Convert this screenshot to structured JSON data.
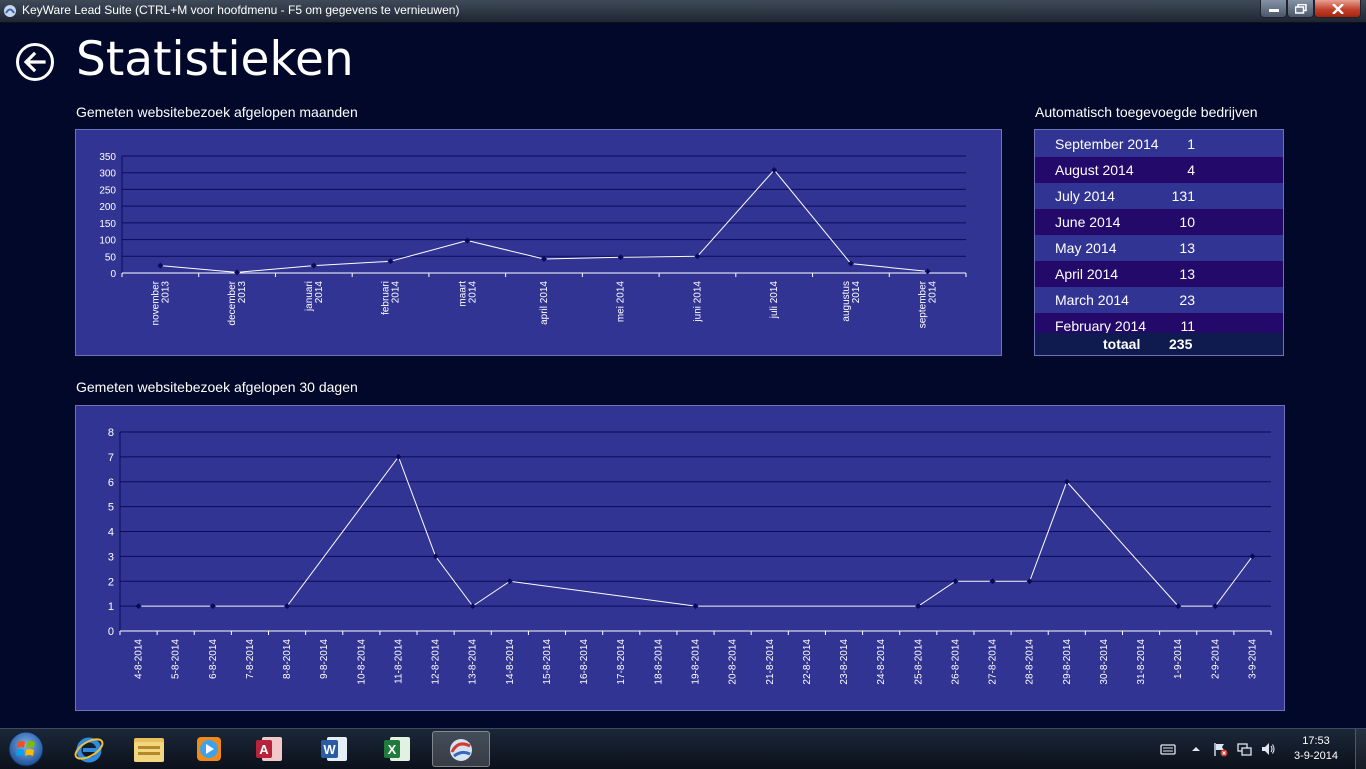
{
  "window": {
    "title": "KeyWare Lead Suite (CTRL+M voor hoofdmenu - F5 om gegevens te vernieuwen)"
  },
  "header": {
    "title": "Statistieken",
    "back_icon": "back-arrow-icon"
  },
  "sections": {
    "monthly_title": "Gemeten websitebezoek afgelopen maanden",
    "daily_title": "Gemeten websitebezoek afgelopen 30 dagen",
    "companies_title": "Automatisch toegevoegde bedrijven"
  },
  "companies": {
    "rows": [
      {
        "month": "September 2014",
        "count": "1"
      },
      {
        "month": "August 2014",
        "count": "4"
      },
      {
        "month": "July 2014",
        "count": "131"
      },
      {
        "month": "June 2014",
        "count": "10"
      },
      {
        "month": "May 2014",
        "count": "13"
      },
      {
        "month": "April 2014",
        "count": "13"
      },
      {
        "month": "March 2014",
        "count": "23"
      },
      {
        "month": "February 2014",
        "count": "11"
      }
    ],
    "total_label": "totaal",
    "total_value": "235"
  },
  "colors": {
    "background": "#010829",
    "panel": "#323494",
    "row_alt": "#230a6a",
    "gridline": "#0a0a5a",
    "line": "#ffffff",
    "marker": "#0a0a5a"
  },
  "chart_data": [
    {
      "type": "line",
      "categories": [
        [
          "november",
          "2013"
        ],
        [
          "december",
          "2013"
        ],
        [
          "januari",
          "2014"
        ],
        [
          "februari",
          "2014"
        ],
        [
          "maart",
          "2014"
        ],
        [
          "april 2014"
        ],
        [
          "mei 2014"
        ],
        [
          "juni 2014"
        ],
        [
          "juli 2014"
        ],
        [
          "augustus",
          "2014"
        ],
        [
          "september",
          "2014"
        ]
      ],
      "values": [
        22,
        2,
        22,
        35,
        97,
        42,
        47,
        50,
        308,
        28,
        5
      ],
      "ylim": [
        0,
        350
      ],
      "yticks": [
        0,
        50,
        100,
        150,
        200,
        250,
        300,
        350
      ],
      "grid": true
    },
    {
      "type": "line",
      "categories": [
        "4-8-2014",
        "5-8-2014",
        "6-8-2014",
        "7-8-2014",
        "8-8-2014",
        "9-8-2014",
        "10-8-2014",
        "11-8-2014",
        "12-8-2014",
        "13-8-2014",
        "14-8-2014",
        "15-8-2014",
        "16-8-2014",
        "17-8-2014",
        "18-8-2014",
        "19-8-2014",
        "20-8-2014",
        "21-8-2014",
        "22-8-2014",
        "23-8-2014",
        "24-8-2014",
        "25-8-2014",
        "26-8-2014",
        "27-8-2014",
        "28-8-2014",
        "29-8-2014",
        "30-8-2014",
        "31-8-2014",
        "1-9-2014",
        "2-9-2014",
        "3-9-2014"
      ],
      "points": [
        {
          "x": "4-8-2014",
          "y": 1
        },
        {
          "x": "6-8-2014",
          "y": 1
        },
        {
          "x": "8-8-2014",
          "y": 1
        },
        {
          "x": "11-8-2014",
          "y": 7
        },
        {
          "x": "12-8-2014",
          "y": 3
        },
        {
          "x": "13-8-2014",
          "y": 1
        },
        {
          "x": "14-8-2014",
          "y": 2
        },
        {
          "x": "19-8-2014",
          "y": 1
        },
        {
          "x": "25-8-2014",
          "y": 1
        },
        {
          "x": "26-8-2014",
          "y": 2
        },
        {
          "x": "27-8-2014",
          "y": 2
        },
        {
          "x": "28-8-2014",
          "y": 2
        },
        {
          "x": "29-8-2014",
          "y": 6
        },
        {
          "x": "1-9-2014",
          "y": 1
        },
        {
          "x": "2-9-2014",
          "y": 1
        },
        {
          "x": "3-9-2014",
          "y": 3
        }
      ],
      "ylim": [
        0,
        8
      ],
      "yticks": [
        0,
        1,
        2,
        3,
        4,
        5,
        6,
        7,
        8
      ],
      "grid": true
    }
  ],
  "taskbar": {
    "items": [
      {
        "name": "internet-explorer-icon"
      },
      {
        "name": "file-explorer-icon"
      },
      {
        "name": "media-player-icon"
      },
      {
        "name": "access-icon"
      },
      {
        "name": "word-icon"
      },
      {
        "name": "excel-icon"
      },
      {
        "name": "keyware-icon",
        "active": true
      }
    ],
    "time": "17:53",
    "date": "3-9-2014"
  }
}
